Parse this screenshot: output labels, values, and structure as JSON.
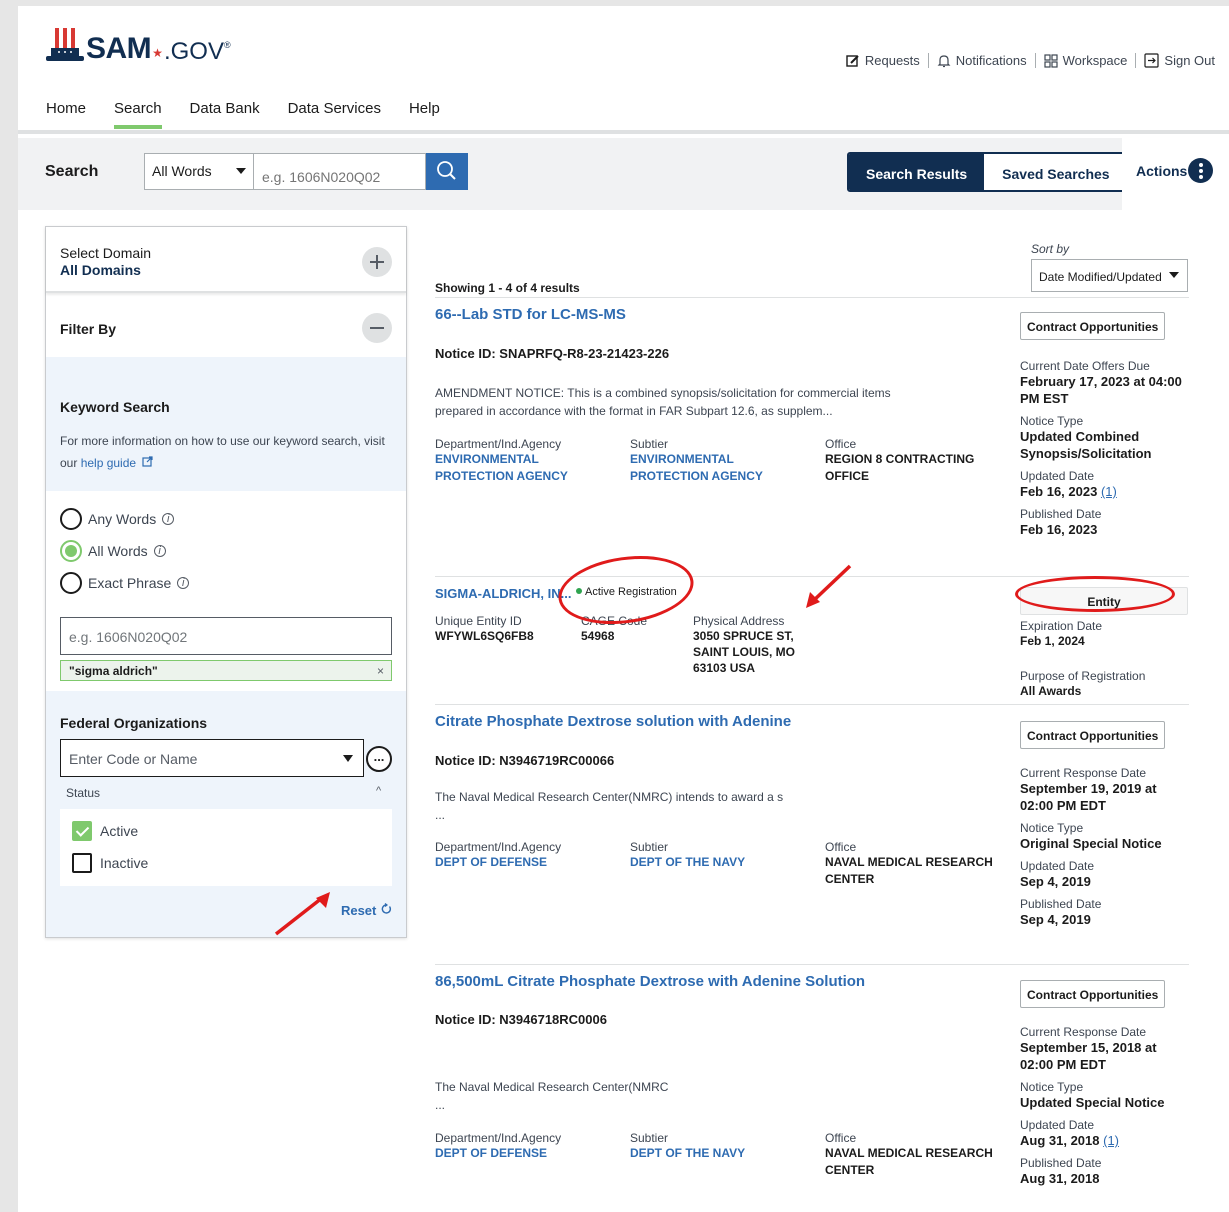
{
  "header": {
    "logo_text": "SAM",
    "logo_suffix": ".GOV",
    "logo_reg": "®",
    "utility": [
      {
        "label": "Requests",
        "icon": "edit-icon"
      },
      {
        "label": "Notifications",
        "icon": "bell-icon"
      },
      {
        "label": "Workspace",
        "icon": "grid-icon"
      },
      {
        "label": "Sign Out",
        "icon": "sign-out-icon"
      }
    ]
  },
  "nav": [
    "Home",
    "Search",
    "Data Bank",
    "Data Services",
    "Help"
  ],
  "nav_active": "Search",
  "search_bar": {
    "label": "Search",
    "select_value": "All Words",
    "input_placeholder": "e.g. 1606N020Q02",
    "tab_results": "Search Results",
    "tab_saved": "Saved Searches",
    "actions_label": "Actions"
  },
  "sidebar": {
    "domain_label": "Select Domain",
    "domain_value": "All Domains",
    "filter_label": "Filter By",
    "keyword_title": "Keyword Search",
    "keyword_desc": "For more information on how to use our keyword search, visit our",
    "keyword_link": "help guide",
    "radios": [
      {
        "label": "Any Words",
        "checked": false
      },
      {
        "label": "All Words",
        "checked": true
      },
      {
        "label": "Exact Phrase",
        "checked": false
      }
    ],
    "keyword_placeholder": "e.g. 1606N020Q02",
    "chip": "\"sigma aldrich\"",
    "chip_close": "×",
    "fed_title": "Federal Organizations",
    "fed_placeholder": "Enter Code or Name",
    "more_label": "...",
    "status_label": "Status",
    "status_caret": "^",
    "status_options": [
      {
        "label": "Active",
        "checked": true
      },
      {
        "label": "Inactive",
        "checked": false
      }
    ],
    "reset_label": "Reset"
  },
  "results_header": {
    "sort_label": "Sort by",
    "sort_value": "Date Modified/Updated",
    "showing": "Showing 1 - 4 of 4 results"
  },
  "results": [
    {
      "title": "66--Lab STD for LC-MS-MS",
      "notice_id": "Notice ID: SNAPRFQ-R8-23-21423-226",
      "desc1": "AMENDMENT NOTICE: This is a combined synopsis/solicitation for commercial items",
      "desc2": "prepared in accordance with the format in FAR Subpart 12.6, as supplem...",
      "dept_label": "Department/Ind.Agency",
      "dept_value": "ENVIRONMENTAL PROTECTION AGENCY",
      "subtier_label": "Subtier",
      "subtier_value": "ENVIRONMENTAL PROTECTION AGENCY",
      "office_label": "Office",
      "office_value": "REGION 8 CONTRACTING OFFICE",
      "badge": "Contract Opportunities",
      "m1_label": "Current Date Offers Due",
      "m1_value": "February 17, 2023 at 04:00 PM EST",
      "m2_label": "Notice Type",
      "m2_value": "Updated Combined Synopsis/Solicitation",
      "m3_label": "Updated Date",
      "m3_value": "Feb 16, 2023",
      "m3_link": "(1)",
      "m4_label": "Published Date",
      "m4_value": "Feb 16, 2023"
    },
    {
      "title": "SIGMA-ALDRICH, IN...",
      "status": "Active Registration",
      "uei_label": "Unique Entity ID",
      "uei_value": "WFYWL6SQ6FB8",
      "cage_label": "CAGE Code",
      "cage_value": "54968",
      "addr_label": "Physical Address",
      "addr_value": "3050 SPRUCE ST, SAINT LOUIS, MO 63103 USA",
      "badge": "Entity",
      "exp_label": "Expiration Date",
      "exp_value": "Feb 1, 2024",
      "purpose_label": "Purpose of Registration",
      "purpose_value": "All Awards"
    },
    {
      "title": "Citrate Phosphate Dextrose solution with Adenine",
      "notice_id": "Notice ID: N3946719RC00066",
      "desc1": "The Naval Medical Research Center(NMRC) intends to award a s",
      "desc2": "...",
      "dept_label": "Department/Ind.Agency",
      "dept_value": "DEPT OF DEFENSE",
      "subtier_label": "Subtier",
      "subtier_value": "DEPT OF THE NAVY",
      "office_label": "Office",
      "office_value": "NAVAL MEDICAL RESEARCH CENTER",
      "badge": "Contract Opportunities",
      "m1_label": "Current Response Date",
      "m1_value": "September 19, 2019 at 02:00 PM EDT",
      "m2_label": "Notice Type",
      "m2_value": "Original Special Notice",
      "m3_label": "Updated Date",
      "m3_value": "Sep 4, 2019",
      "m4_label": "Published Date",
      "m4_value": "Sep 4, 2019"
    },
    {
      "title": "86,500mL Citrate Phosphate Dextrose with Adenine Solution",
      "notice_id": "Notice ID: N3946718RC0006",
      "desc1": "The Naval Medical Research Center(NMRC",
      "desc2": "...",
      "dept_label": "Department/Ind.Agency",
      "dept_value": "DEPT OF DEFENSE",
      "subtier_label": "Subtier",
      "subtier_value": "DEPT OF THE NAVY",
      "office_label": "Office",
      "office_value": "NAVAL MEDICAL RESEARCH CENTER",
      "badge": "Contract Opportunities",
      "m1_label": "Current Response Date",
      "m1_value": "September 15, 2018 at 02:00 PM EDT",
      "m2_label": "Notice Type",
      "m2_value": "Updated Special Notice",
      "m3_label": "Updated Date",
      "m3_value": "Aug 31, 2018",
      "m3_link": "(1)",
      "m4_label": "Published Date",
      "m4_value": "Aug 31, 2018"
    }
  ],
  "colors": {
    "brand_navy": "#112e51",
    "link_blue": "#2e6bb1",
    "accent_green": "#7fc96d",
    "annotation_red": "#e01b1b"
  }
}
